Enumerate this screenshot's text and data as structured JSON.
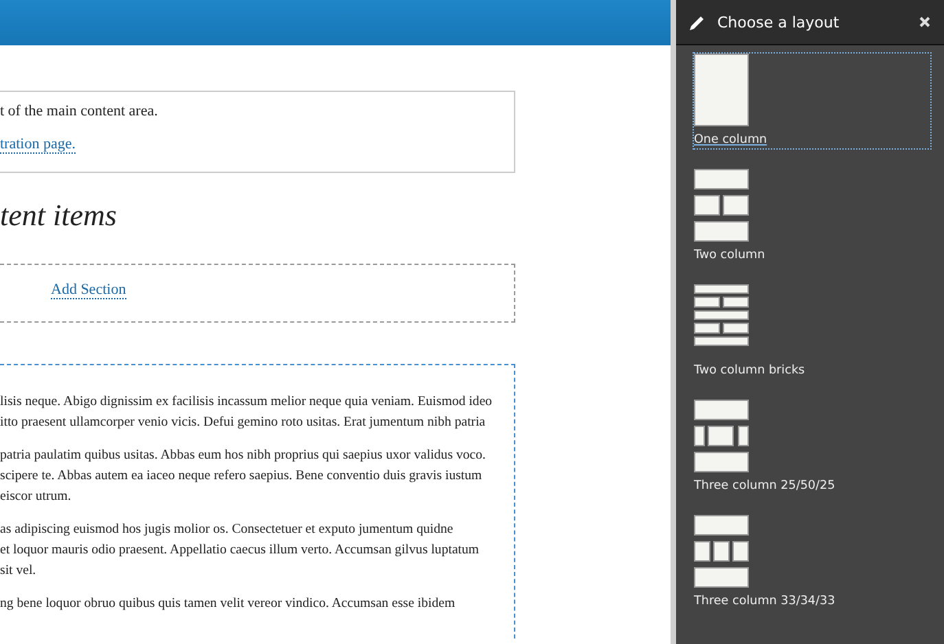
{
  "main": {
    "message": {
      "text": "t of the main content area.",
      "link": "tration page."
    },
    "heading": "tent items",
    "add_section": "Add Section",
    "paragraphs": [
      {
        "lines": [
          "lisis neque. Abigo dignissim ex facilisis incassum melior neque quia veniam. Euismod ideo",
          "itto praesent ullamcorper venio vicis. Defui gemino roto usitas. Erat jumentum nibh patria"
        ]
      },
      {
        "lines": [
          " patria paulatim quibus usitas. Abbas eum hos nibh proprius qui saepius uxor validus voco.",
          "scipere te. Abbas autem ea iaceo neque refero saepius. Bene conventio duis gravis iustum",
          "eiscor utrum."
        ]
      },
      {
        "lines": [
          "as adipiscing euismod hos jugis molior os. Consectetuer et exputo jumentum quidne",
          "et loquor mauris odio praesent. Appellatio caecus illum verto. Accumsan gilvus luptatum",
          "sit vel."
        ]
      },
      {
        "lines": [
          "ng bene loquor obruo quibus quis tamen velit vereor vindico. Accumsan esse ibidem"
        ]
      }
    ]
  },
  "panel": {
    "title": "Choose a layout",
    "layouts": [
      {
        "label": "One column",
        "kind": "one",
        "selected": true
      },
      {
        "label": "Two column",
        "kind": "two",
        "selected": false
      },
      {
        "label": "Two column bricks",
        "kind": "bricks",
        "selected": false
      },
      {
        "label": "Three column 25/50/25",
        "kind": "three25",
        "selected": false
      },
      {
        "label": "Three column 33/34/33",
        "kind": "three33",
        "selected": false
      }
    ]
  }
}
